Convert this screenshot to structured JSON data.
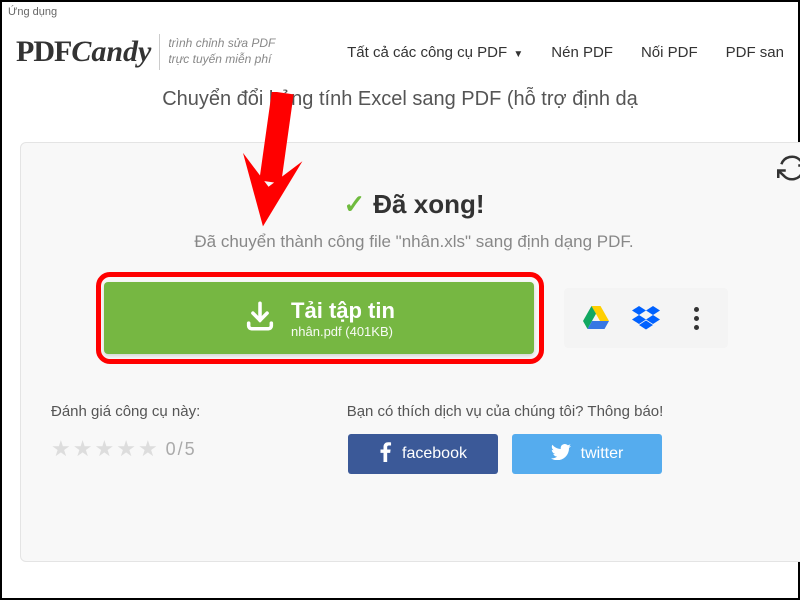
{
  "app_label": "Ứng dụng",
  "logo": {
    "part1": "PDF",
    "part2": "Candy",
    "tagline1": "trình chỉnh sửa PDF",
    "tagline2": "trực tuyến miễn phí"
  },
  "nav": {
    "tools": "Tất cả các công cụ PDF",
    "compress": "Nén PDF",
    "merge": "Nối PDF",
    "pdf_to": "PDF san"
  },
  "subtitle": "Chuyển đổi bảng tính Excel sang PDF (hỗ trợ định dạ",
  "done": {
    "title": "Đã xong!",
    "message": "Đã chuyển thành công file \"nhân.xls\" sang định dạng PDF."
  },
  "download": {
    "label": "Tải tập tin",
    "filename": "nhân.pdf (401KB)"
  },
  "rating": {
    "label": "Đánh giá công cụ này:",
    "score": "0/5"
  },
  "share": {
    "label": "Bạn có thích dịch vụ của chúng tôi? Thông báo!",
    "facebook": "facebook",
    "twitter": "twitter"
  }
}
